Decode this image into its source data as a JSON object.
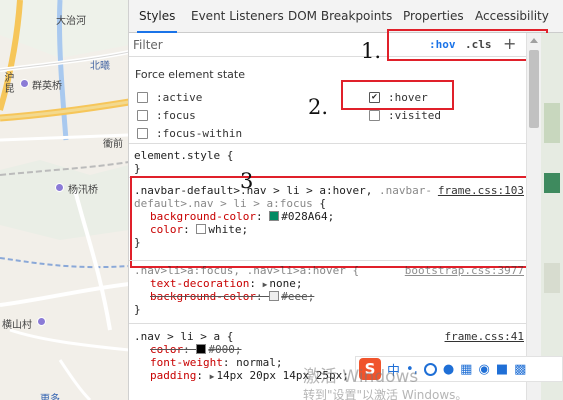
{
  "map": {
    "labels": {
      "dayehe": "大治河",
      "qunying_bridge": "群英桥",
      "beiyong": "北曦",
      "hudiao": "沪昆",
      "jie": "衝前",
      "yangxun_bridge": "杨汛桥",
      "hengshan_village": "横山村",
      "more": "更多"
    }
  },
  "devtools": {
    "tabs": [
      "Styles",
      "Event Listeners",
      "DOM Breakpoints",
      "Properties",
      "Accessibility"
    ],
    "active_tab": "Styles",
    "filter": {
      "placeholder": "Filter",
      "value": ""
    },
    "toolbar": {
      "hov": ":hov",
      "cls": ".cls",
      "add": "+"
    },
    "force_state": {
      "title": "Force element state",
      "states": [
        {
          "label": ":active",
          "checked": false
        },
        {
          "label": ":focus",
          "checked": false
        },
        {
          "label": ":focus-within",
          "checked": false
        },
        {
          "label": ":hover",
          "checked": true
        },
        {
          "label": ":visited",
          "checked": false
        }
      ]
    },
    "annotations": {
      "one": "1.",
      "two": "2.",
      "three": "3"
    },
    "element_style": {
      "open": "element.style {",
      "close": "}"
    },
    "rule1": {
      "selector_match": ".navbar-default>.nav > li > a:hover,",
      "selector_dim_1": " .navbar-",
      "selector_dim_2": "default>.nav > li > a:focus",
      "brace": " {",
      "source": "frame.css:103",
      "decl1_prop": "background-color",
      "decl1_value": "#028A64",
      "decl1_color": "#028A64",
      "decl2_prop": "color",
      "decl2_value": "white",
      "decl2_color": "#ffffff",
      "close": "}"
    },
    "rule2": {
      "selector": ".nav>li>a:focus, .nav>li>a:hover {",
      "source": "bootstrap.css:3977",
      "decl1_prop": "text-decoration",
      "decl1_value": "none",
      "decl2_prop": "background-color",
      "decl2_value": "#eee",
      "decl2_color": "#eeeeee",
      "close": "}"
    },
    "rule3": {
      "selector": ".nav > li > a {",
      "source": "frame.css:41",
      "decl1_prop": "color",
      "decl1_value": "#000",
      "decl1_color": "#000000",
      "decl2_prop": "font-weight",
      "decl2_value": "normal",
      "decl3_prop": "padding",
      "decl3_value": "14px 20px 14px 25px"
    }
  },
  "ime": {
    "logo": "S",
    "lang": "中",
    "punct": "•,"
  },
  "watermark": {
    "line1": "激活 Windows",
    "line2": "转到\"设置\"以激活 Windows。"
  },
  "colors": {
    "annotation_red": "#e0202a",
    "tab_accent": "#1a73e8",
    "css_property": "#c80000"
  }
}
